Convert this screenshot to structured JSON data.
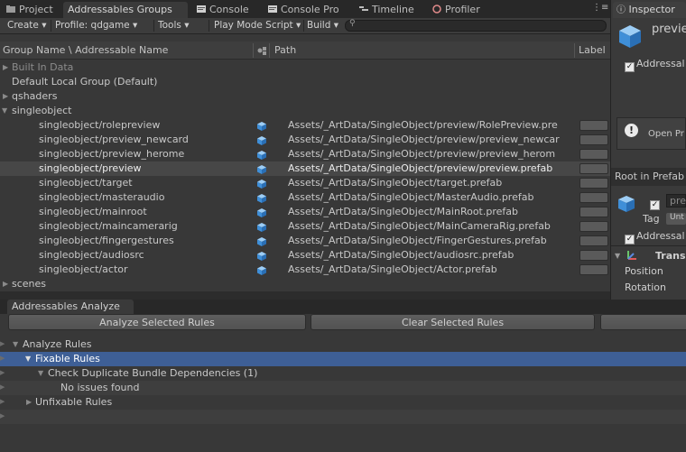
{
  "tabs": [
    {
      "label": "Project",
      "icon": "project-icon"
    },
    {
      "label": "Addressables Groups",
      "icon": "",
      "active": true
    },
    {
      "label": "Console",
      "icon": "console-icon"
    },
    {
      "label": "Console Pro",
      "icon": "console-pro-icon"
    },
    {
      "label": "Timeline",
      "icon": "timeline-icon"
    },
    {
      "label": "Profiler",
      "icon": "profiler-icon"
    }
  ],
  "toolbar": {
    "create": "Create",
    "profile": "Profile: qdgame",
    "tools": "Tools",
    "play_mode": "Play Mode Script",
    "build": "Build",
    "search_placeholder": ""
  },
  "columns": {
    "group_name": "Group Name \\ Addressable Name",
    "path": "Path",
    "labels": "Label"
  },
  "tree": {
    "groups": [
      {
        "label": "Built In Data",
        "expanded": false,
        "dim": true
      },
      {
        "label": "Default Local Group (Default)",
        "expanded": false
      },
      {
        "label": "qshaders",
        "expanded": false
      },
      {
        "label": "singleobject",
        "expanded": true
      }
    ],
    "entries": [
      {
        "name": "singleobject/rolepreview",
        "path": "Assets/_ArtData/SingleObject/preview/RolePreview.pre"
      },
      {
        "name": "singleobject/preview_newcard",
        "path": "Assets/_ArtData/SingleObject/preview/preview_newcar"
      },
      {
        "name": "singleobject/preview_herome",
        "path": "Assets/_ArtData/SingleObject/preview/preview_herom"
      },
      {
        "name": "singleobject/preview",
        "path": "Assets/_ArtData/SingleObject/preview/preview.prefab",
        "selected": true
      },
      {
        "name": "singleobject/target",
        "path": "Assets/_ArtData/SingleObject/target.prefab"
      },
      {
        "name": "singleobject/masteraudio",
        "path": "Assets/_ArtData/SingleObject/MasterAudio.prefab"
      },
      {
        "name": "singleobject/mainroot",
        "path": "Assets/_ArtData/SingleObject/MainRoot.prefab"
      },
      {
        "name": "singleobject/maincamerarig",
        "path": "Assets/_ArtData/SingleObject/MainCameraRig.prefab"
      },
      {
        "name": "singleobject/fingergestures",
        "path": "Assets/_ArtData/SingleObject/FingerGestures.prefab"
      },
      {
        "name": "singleobject/audiosrc",
        "path": "Assets/_ArtData/SingleObject/audiosrc.prefab"
      },
      {
        "name": "singleobject/actor",
        "path": "Assets/_ArtData/SingleObject/Actor.prefab"
      }
    ],
    "trailing_group": "scenes"
  },
  "analyze": {
    "tab_label": "Addressables Analyze",
    "analyze_button": "Analyze Selected Rules",
    "clear_button": "Clear Selected Rules",
    "root": "Analyze Rules",
    "fixable": "Fixable Rules",
    "duplicate_rule": "Check Duplicate Bundle Dependencies (1)",
    "no_issues": "No issues found",
    "unfixable": "Unfixable Rules"
  },
  "inspector": {
    "tab_label": "Inspector",
    "object_name": "previe",
    "addressable_label": "Addressal",
    "open_prefab": "Open Pr",
    "root_in_prefab": "Root in Prefab",
    "child_name": "preview",
    "tag_label": "Tag",
    "tag_value": "Unt",
    "addressable_label2": "Addressal",
    "transform": "Trans",
    "position": "Position",
    "rotation": "Rotation"
  },
  "colors": {
    "selection_blue": "#3e5f96",
    "prefab_blue": "#4a9cf0"
  }
}
